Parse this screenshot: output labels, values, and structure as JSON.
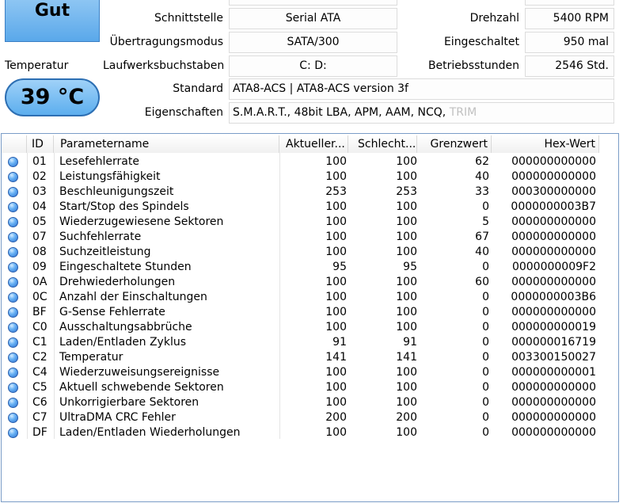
{
  "health": {
    "status": "Gut"
  },
  "temperature": {
    "label": "Temperatur",
    "value": "39 °C"
  },
  "info": {
    "interface": {
      "label": "Schnittstelle",
      "value": "Serial ATA"
    },
    "transfer_mode": {
      "label": "Übertragungsmodus",
      "value": "SATA/300"
    },
    "drive_letters": {
      "label": "Laufwerksbuchstaben",
      "value": "C: D:"
    },
    "standard": {
      "label": "Standard",
      "value": "ATA8-ACS | ATA8-ACS version 3f"
    },
    "features": {
      "label": "Eigenschaften",
      "value": "S.M.A.R.T., 48bit LBA, APM, AAM, NCQ,",
      "disabled": "TRIM"
    },
    "rotation": {
      "label": "Drehzahl",
      "value": "5400 RPM"
    },
    "power_on_count": {
      "label": "Eingeschaltet",
      "value": "950 mal"
    },
    "power_on_hours": {
      "label": "Betriebsstunden",
      "value": "2546 Std."
    }
  },
  "smart": {
    "columns": {
      "id": "ID",
      "name": "Parametername",
      "current": "Aktueller...",
      "worst": "Schlecht...",
      "threshold": "Grenzwert",
      "raw": "Hex-Wert"
    },
    "rows": [
      {
        "id": "01",
        "name": "Lesefehlerrate",
        "current": "100",
        "worst": "100",
        "threshold": "62",
        "raw": "000000000000"
      },
      {
        "id": "02",
        "name": "Leistungsfähigkeit",
        "current": "100",
        "worst": "100",
        "threshold": "40",
        "raw": "000000000000"
      },
      {
        "id": "03",
        "name": "Beschleunigungszeit",
        "current": "253",
        "worst": "253",
        "threshold": "33",
        "raw": "000300000000"
      },
      {
        "id": "04",
        "name": "Start/Stop des Spindels",
        "current": "100",
        "worst": "100",
        "threshold": "0",
        "raw": "0000000003B7"
      },
      {
        "id": "05",
        "name": "Wiederzugewiesene Sektoren",
        "current": "100",
        "worst": "100",
        "threshold": "5",
        "raw": "000000000000"
      },
      {
        "id": "07",
        "name": "Suchfehlerrate",
        "current": "100",
        "worst": "100",
        "threshold": "67",
        "raw": "000000000000"
      },
      {
        "id": "08",
        "name": "Suchzeitleistung",
        "current": "100",
        "worst": "100",
        "threshold": "40",
        "raw": "000000000000"
      },
      {
        "id": "09",
        "name": "Eingeschaltete Stunden",
        "current": "95",
        "worst": "95",
        "threshold": "0",
        "raw": "0000000009F2"
      },
      {
        "id": "0A",
        "name": "Drehwiederholungen",
        "current": "100",
        "worst": "100",
        "threshold": "60",
        "raw": "000000000000"
      },
      {
        "id": "0C",
        "name": "Anzahl der Einschaltungen",
        "current": "100",
        "worst": "100",
        "threshold": "0",
        "raw": "0000000003B6"
      },
      {
        "id": "BF",
        "name": "G-Sense Fehlerrate",
        "current": "100",
        "worst": "100",
        "threshold": "0",
        "raw": "000000000000"
      },
      {
        "id": "C0",
        "name": "Ausschaltungsabbrüche",
        "current": "100",
        "worst": "100",
        "threshold": "0",
        "raw": "000000000019"
      },
      {
        "id": "C1",
        "name": "Laden/Entladen Zyklus",
        "current": "91",
        "worst": "91",
        "threshold": "0",
        "raw": "000000016719"
      },
      {
        "id": "C2",
        "name": "Temperatur",
        "current": "141",
        "worst": "141",
        "threshold": "0",
        "raw": "003300150027"
      },
      {
        "id": "C4",
        "name": "Wiederzuweisungsereignisse",
        "current": "100",
        "worst": "100",
        "threshold": "0",
        "raw": "000000000001"
      },
      {
        "id": "C5",
        "name": "Aktuell schwebende Sektoren",
        "current": "100",
        "worst": "100",
        "threshold": "0",
        "raw": "000000000000"
      },
      {
        "id": "C6",
        "name": "Unkorrigierbare Sektoren",
        "current": "100",
        "worst": "100",
        "threshold": "0",
        "raw": "000000000000"
      },
      {
        "id": "C7",
        "name": "UltraDMA CRC Fehler",
        "current": "200",
        "worst": "200",
        "threshold": "0",
        "raw": "000000000000"
      },
      {
        "id": "DF",
        "name": "Laden/Entladen Wiederholungen",
        "current": "100",
        "worst": "100",
        "threshold": "0",
        "raw": "000000000000"
      }
    ]
  }
}
